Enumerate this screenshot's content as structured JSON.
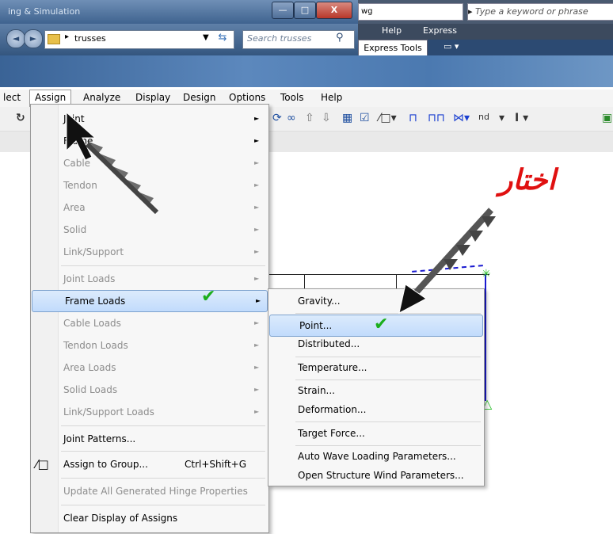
{
  "window": {
    "title": "ing & Simulation",
    "buttons": {
      "minimize": "—",
      "maximize": "□",
      "close": "X"
    }
  },
  "explorer": {
    "path": "trusses",
    "search_placeholder": "Search trusses"
  },
  "right_app": {
    "filename": "wg",
    "keyword_placeholder": "Type a keyword or phrase",
    "menu": [
      "Help",
      "Express"
    ],
    "tab": "Express Tools"
  },
  "menubar": {
    "items": [
      "lect",
      "Assign",
      "Analyze",
      "Display",
      "Design",
      "Options",
      "Tools",
      "Help"
    ]
  },
  "toolbar_text": {
    "nd": "nd"
  },
  "assign_menu": {
    "items": [
      {
        "label": "Joint",
        "arrow": "►",
        "disabled": false
      },
      {
        "label": "Frame",
        "arrow": "►",
        "disabled": false
      },
      {
        "label": "Cable",
        "arrow": "►",
        "disabled": true
      },
      {
        "label": "Tendon",
        "arrow": "►",
        "disabled": true
      },
      {
        "label": "Area",
        "arrow": "►",
        "disabled": true
      },
      {
        "label": "Solid",
        "arrow": "►",
        "disabled": true
      },
      {
        "label": "Link/Support",
        "arrow": "►",
        "disabled": true
      },
      {
        "label": "Joint Loads",
        "arrow": "►",
        "disabled": true
      },
      {
        "label": "Frame Loads",
        "arrow": "►",
        "disabled": false
      },
      {
        "label": "Cable Loads",
        "arrow": "►",
        "disabled": true
      },
      {
        "label": "Tendon Loads",
        "arrow": "►",
        "disabled": true
      },
      {
        "label": "Area Loads",
        "arrow": "►",
        "disabled": true
      },
      {
        "label": "Solid Loads",
        "arrow": "►",
        "disabled": true
      },
      {
        "label": "Link/Support Loads",
        "arrow": "►",
        "disabled": true
      },
      {
        "label": "Joint Patterns...",
        "disabled": false
      },
      {
        "label": "Assign to Group...",
        "shortcut": "Ctrl+Shift+G",
        "disabled": false
      },
      {
        "label": "Update All Generated Hinge Properties",
        "disabled": true
      },
      {
        "label": "Clear Display of Assigns",
        "disabled": false
      }
    ],
    "group_icon": "⁄□"
  },
  "frame_loads_submenu": {
    "items": [
      "Gravity...",
      "Point...",
      "Distributed...",
      "Temperature...",
      "Strain...",
      "Deformation...",
      "Target Force...",
      "Auto Wave Loading Parameters...",
      "Open Structure Wind Parameters..."
    ]
  },
  "annotation": {
    "arabic_text": "اختار",
    "check_mark": "✔",
    "color": "#e01010"
  }
}
